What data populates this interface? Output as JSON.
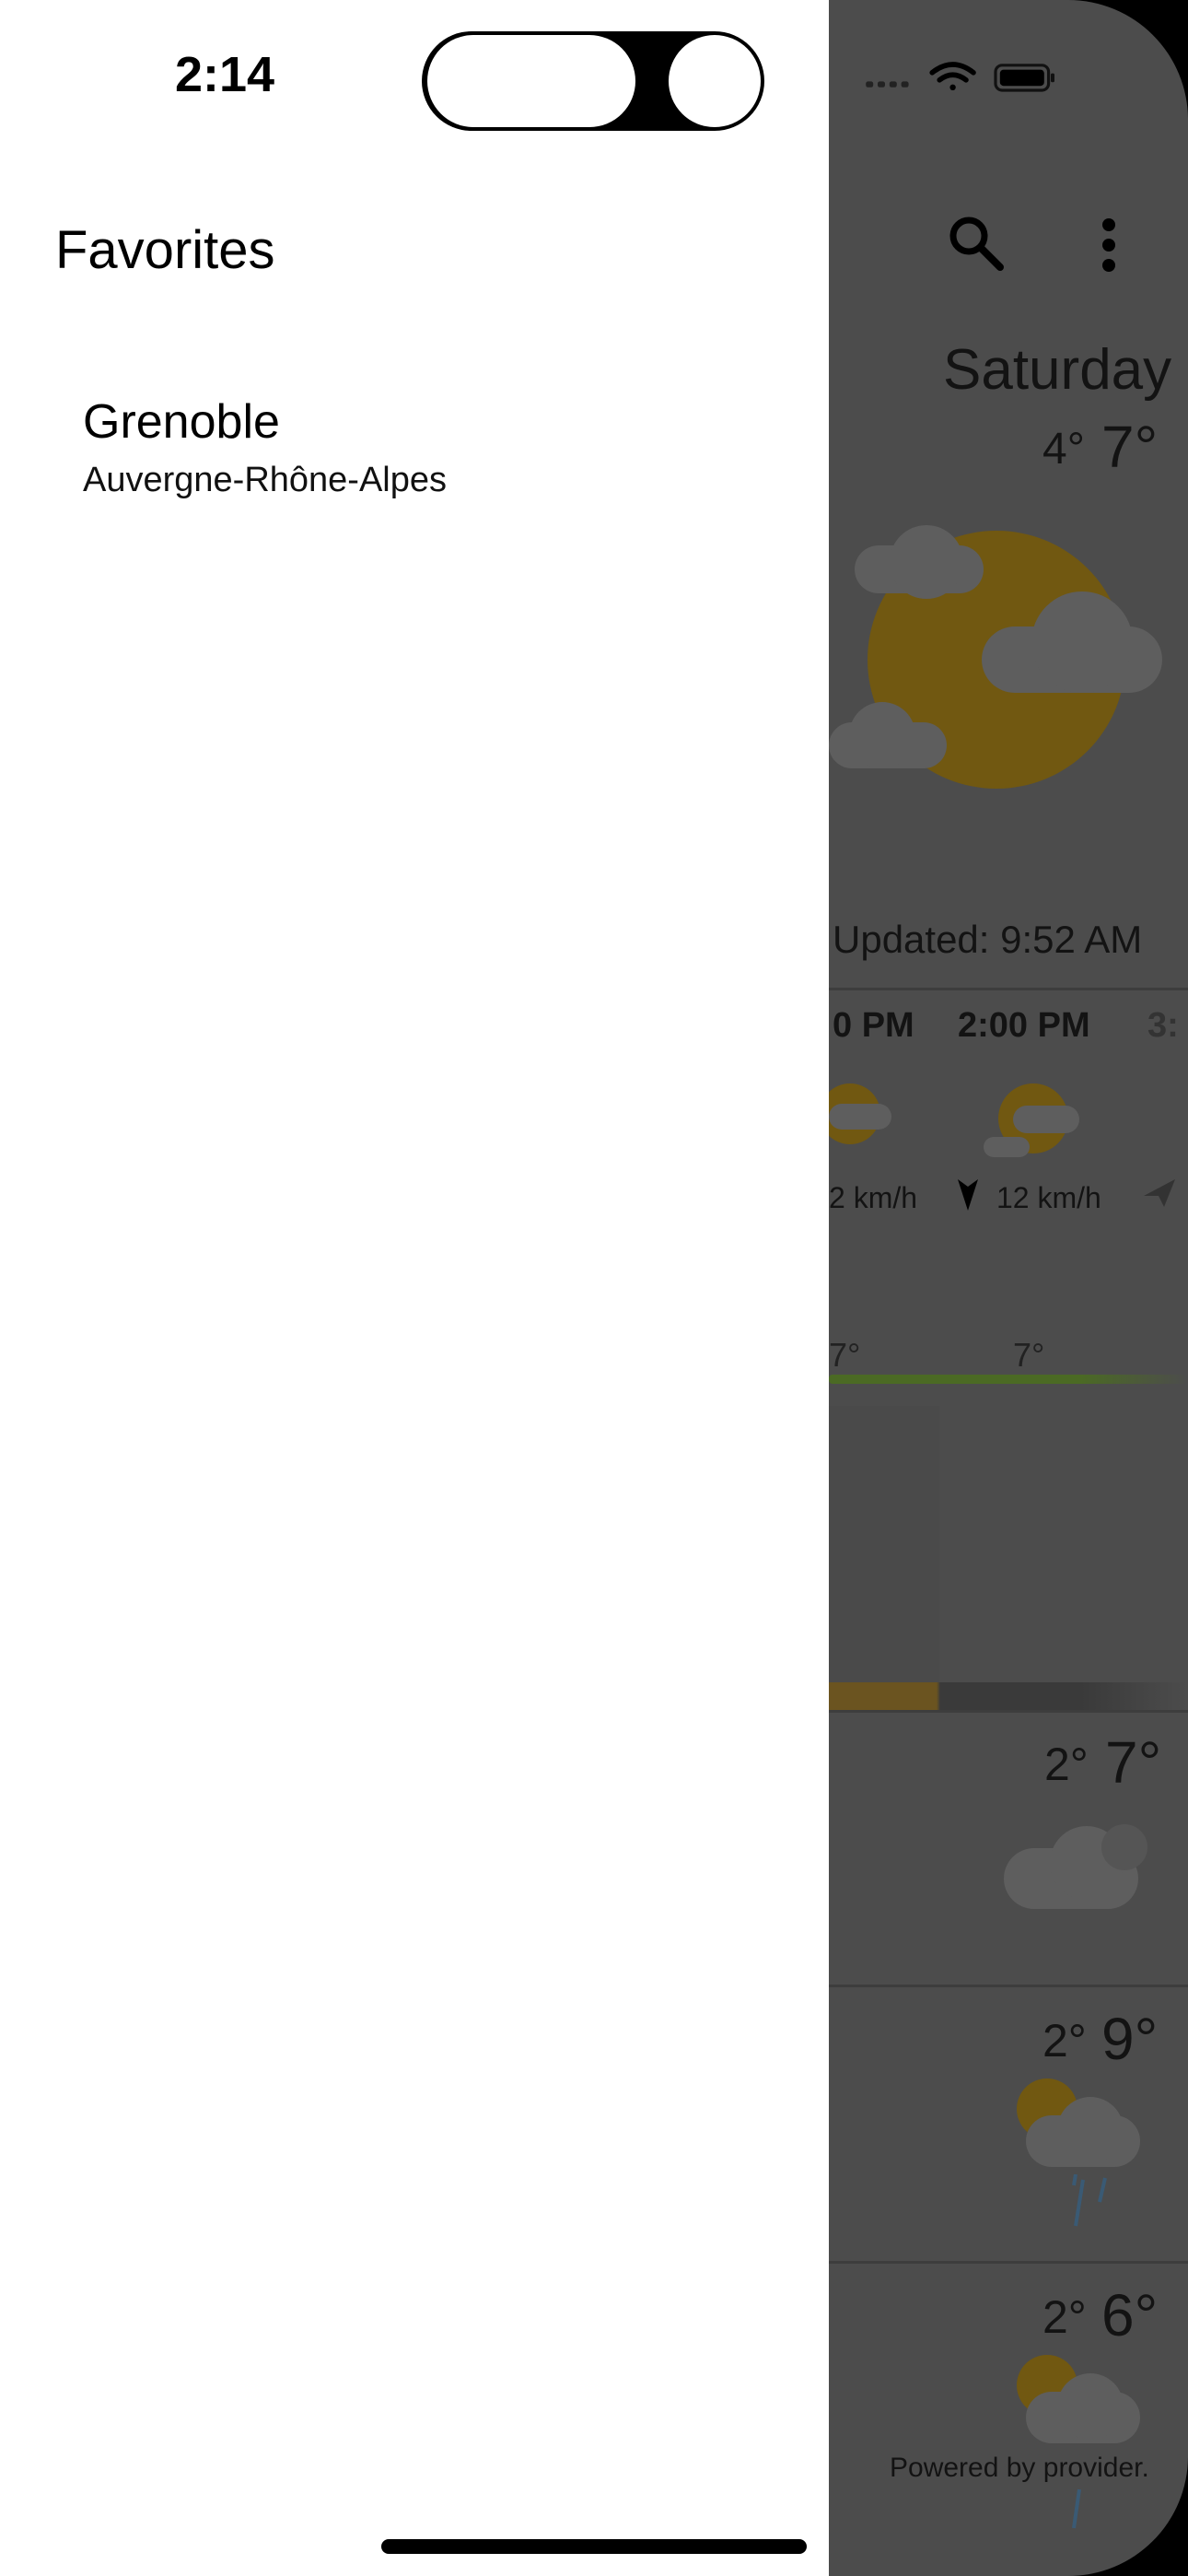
{
  "status_bar": {
    "time": "2:14"
  },
  "drawer": {
    "title": "Favorites",
    "favorites": [
      {
        "city": "Grenoble",
        "region": "Auvergne-Rhône-Alpes"
      }
    ]
  },
  "background_app": {
    "day": "Saturday",
    "current_low": "4°",
    "current_high": "7°",
    "updated": "Updated: 9:52 AM",
    "hourly": [
      {
        "time": "0 PM",
        "wind": "2  km/h",
        "temp": "7°"
      },
      {
        "time": "2:00 PM",
        "wind": "12  km/h",
        "temp": "7°"
      },
      {
        "time": "3:"
      }
    ],
    "daily": [
      {
        "low": "2°",
        "high": "7°",
        "icon": "cloudy-icon"
      },
      {
        "low": "2°",
        "high": "9°",
        "icon": "sun-cloud-rain-icon"
      },
      {
        "low": "2°",
        "high": "6°",
        "icon": "sun-cloud-rain-icon"
      }
    ],
    "footer": "Powered by provider."
  },
  "colors": {
    "scrim": "#4c4c4c",
    "drawer_background": "#ffffff",
    "sun_dimmed": "#715811",
    "temp_line_dimmed": "#4b6a24"
  }
}
